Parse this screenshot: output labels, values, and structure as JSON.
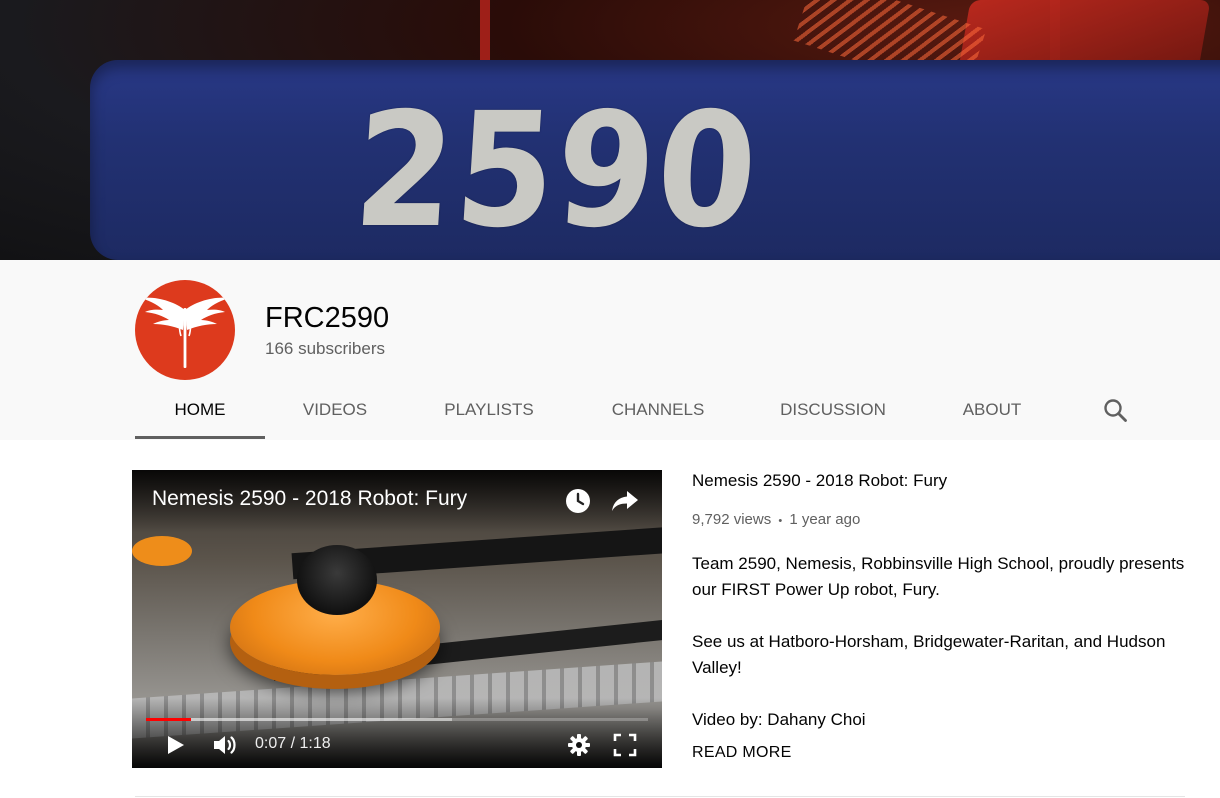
{
  "banner": {
    "bumper_text": "2590"
  },
  "channel": {
    "name": "FRC2590",
    "subscribers": "166 subscribers",
    "avatar_color": "#dd3a1d"
  },
  "tabs": [
    {
      "label": "HOME",
      "active": true
    },
    {
      "label": "VIDEOS"
    },
    {
      "label": "PLAYLISTS"
    },
    {
      "label": "CHANNELS"
    },
    {
      "label": "DISCUSSION"
    },
    {
      "label": "ABOUT"
    }
  ],
  "search_icon": "search-icon",
  "player": {
    "title": "Nemesis 2590 - 2018 Robot: Fury",
    "time": "0:07 / 1:18",
    "progress_played": 0.09,
    "progress_loaded": 0.61,
    "icons": [
      "watch-later-icon",
      "share-icon",
      "play-icon",
      "volume-icon",
      "settings-icon",
      "fullscreen-icon"
    ]
  },
  "video_info": {
    "title": "Nemesis 2590 - 2018 Robot: Fury",
    "views": "9,792 views",
    "separator": "•",
    "age": "1 year ago",
    "description": [
      "Team 2590, Nemesis, Robbinsville High School,  proudly presents our FIRST Power Up robot, Fury.",
      "See us at Hatboro-Horsham, Bridgewater-Raritan, and Hudson Valley!",
      "Video by: Dahany Choi"
    ],
    "read_more": "READ MORE"
  },
  "colors": {
    "accent_red": "#ff0000",
    "tab_underline": "#606060",
    "header_bg": "#f9f9f9"
  }
}
